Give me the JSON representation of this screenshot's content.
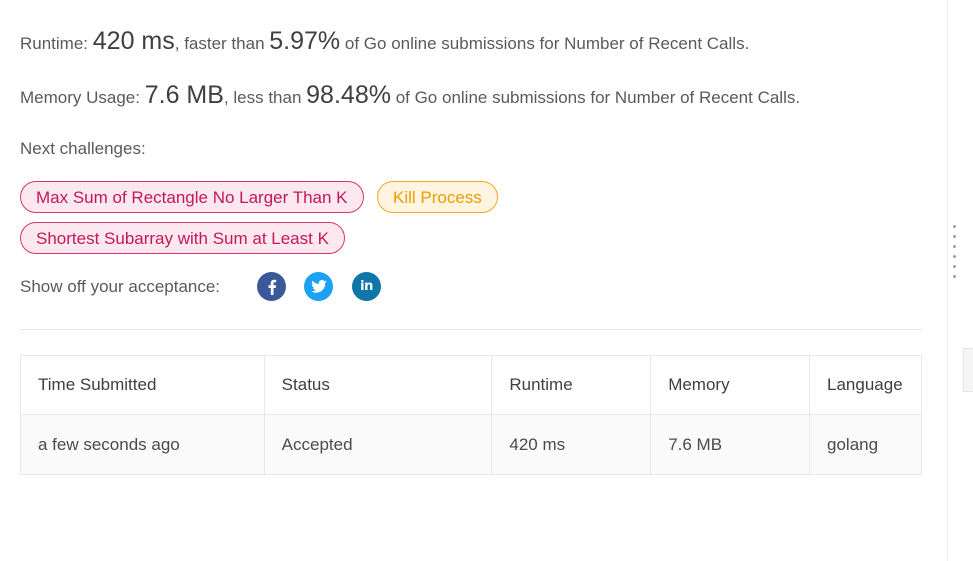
{
  "result": {
    "runtime_label": "Runtime:",
    "runtime_value": "420 ms",
    "runtime_mid": ", faster than",
    "runtime_percent": "5.97%",
    "runtime_tail": "of Go online submissions for Number of Recent Calls.",
    "memory_label": "Memory Usage:",
    "memory_value": "7.6 MB",
    "memory_mid": ", less than",
    "memory_percent": "98.48%",
    "memory_tail": "of Go online submissions for Number of Recent Calls."
  },
  "next_challenges": {
    "label": "Next challenges:",
    "items": [
      {
        "title": "Max Sum of Rectangle No Larger Than K",
        "difficulty": "hard"
      },
      {
        "title": "Kill Process",
        "difficulty": "medium"
      },
      {
        "title": "Shortest Subarray with Sum at Least K",
        "difficulty": "hard"
      }
    ]
  },
  "share": {
    "label": "Show off your acceptance:",
    "icons": [
      "facebook-icon",
      "twitter-icon",
      "linkedin-icon"
    ],
    "linkedin_text": "in"
  },
  "submissions": {
    "headers": [
      "Time Submitted",
      "Status",
      "Runtime",
      "Memory",
      "Language"
    ],
    "rows": [
      [
        "a few seconds ago",
        "Accepted",
        "420 ms",
        "7.6 MB",
        "golang"
      ]
    ]
  },
  "colors": {
    "hard": "#c2185b",
    "medium": "#ef9c00",
    "accepted": "#2db55d",
    "facebook": "#3b5998",
    "twitter": "#1da1f2",
    "linkedin": "#0e76a8"
  }
}
